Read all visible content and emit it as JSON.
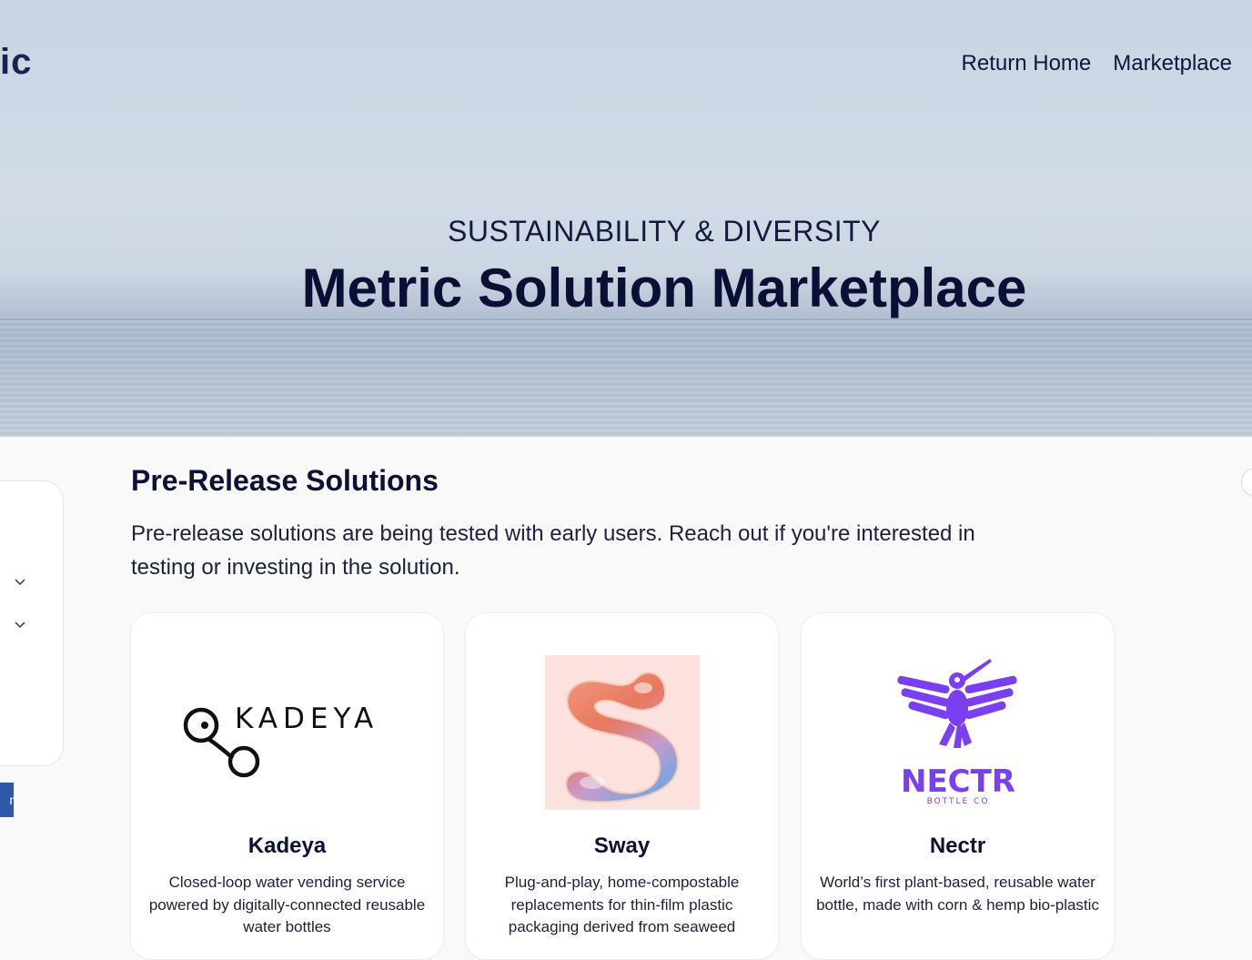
{
  "header": {
    "logo_fragment": "ic",
    "nav": [
      {
        "label": "Return Home"
      },
      {
        "label": "Marketplace"
      }
    ]
  },
  "hero": {
    "subtitle": "SUSTAINABILITY & DIVERSITY",
    "title": "Metric Solution Marketplace"
  },
  "sidebar": {
    "button_fragment": "r"
  },
  "section": {
    "title": "Pre-Release Solutions",
    "description": "Pre-release solutions are being tested with early users. Reach out if you're interested in testing or investing in the solution."
  },
  "cards": [
    {
      "name": "Kadeya",
      "logo_text": "KADEYA",
      "description": "Closed-loop water vending service powered by digitally-connected reusable water bottles"
    },
    {
      "name": "Sway",
      "description": "Plug-and-play, home-compostable replacements for thin-film plastic packaging derived from seaweed"
    },
    {
      "name": "Nectr",
      "logo_text": "NECTR",
      "logo_subtext": "BOTTLE CO",
      "description": "World’s first plant-based, reusable water bottle, made with corn & hemp bio-plastic"
    }
  ],
  "colors": {
    "brand_dark": "#0d1136",
    "nectr_purple": "#7a3ff0",
    "button_blue": "#2f58a8"
  }
}
